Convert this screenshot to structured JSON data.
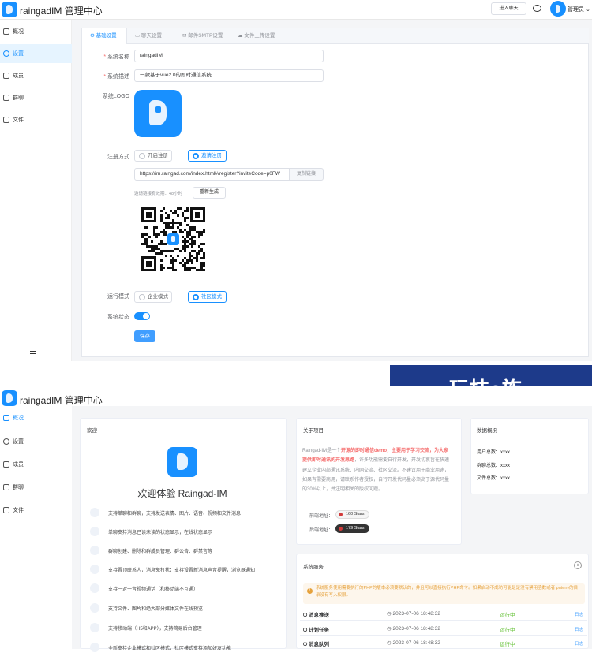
{
  "app": {
    "title": "raingadIM 管理中心",
    "enter_chat": "进入聊天",
    "user": "管理员"
  },
  "sidebar": {
    "items": [
      {
        "label": "概况",
        "icon": "dashboard-icon"
      },
      {
        "label": "设置",
        "icon": "gear-icon"
      },
      {
        "label": "成员",
        "icon": "user-icon"
      },
      {
        "label": "群聊",
        "icon": "chat-icon"
      },
      {
        "label": "文件",
        "icon": "folder-icon"
      }
    ]
  },
  "settings": {
    "tabs": [
      {
        "label": "基础设置",
        "icon": "gear-icon"
      },
      {
        "label": "聊天设置",
        "icon": "chat-icon"
      },
      {
        "label": "邮件SMTP设置",
        "icon": "mail-icon"
      },
      {
        "label": "文件上传设置",
        "icon": "cloud-upload-icon"
      }
    ],
    "name_label": "系统名称",
    "name_value": "raingadIM",
    "desc_label": "系统描述",
    "desc_value": "一款基于vue2.0的即时通信系统",
    "logo_label": "系统LOGO",
    "register_label": "注册方式",
    "register_options": [
      "开启注册",
      "邀请注册"
    ],
    "register_selected": "邀请注册",
    "invite_link": "https://im.raingad.com/index.html#/register?inviteCode=p0FW",
    "copy_link": "复制链接",
    "invite_hint": "邀请链接有效期：48小时",
    "regenerate": "重新生成",
    "mode_label": "运行模式",
    "mode_options": [
      "企业模式",
      "社区模式"
    ],
    "mode_selected": "社区模式",
    "status_label": "系统状态",
    "status_on": true,
    "save": "保存"
  },
  "banner": {
    "text": "玩技e族",
    "color": "#1d3a8a"
  },
  "welcome": {
    "panel_title": "欢迎",
    "title": "欢迎体验 Raingad-IM",
    "features": [
      "支持单聊和群聊，支持发送表情、图片、语音、视频和文件消息",
      "单聊支持消息已读未读的状态显示，在线状态显示",
      "群聊创建、删除和群成员管理、群公告、群禁言等",
      "支持置顶联系人，消息免打扰；支持设置新消息声音提醒，浏览器通知",
      "支持一对一音视频通话（和移动端不互通）",
      "支持文件、图片和绝大部分媒体文件在线预览",
      "支持移动端（H5和APP），支持简易后台管理",
      "全新支持企业模式和社区模式，社区模式支持添加好友功能"
    ]
  },
  "about": {
    "title": "关于项目",
    "text_a": "Raingad-IM是一个",
    "text_hl": "开源的即时通信demo，主要用于学习交流，为大家提供即时通讯的开发思路",
    "text_b": "，许多功能需要自行开发，开发初衷旨在快速建立企业内部通讯系统、内网交流、社区交流。不建议用于商业用途，如果有需要商用，请联系作者授权，自行开发代码量必须高于源代码量的30%以上，并注明相关的版权问题。",
    "frontend_label": "前端地址：",
    "frontend_stars": "160 Stars",
    "backend_label": "后端地址：",
    "backend_stars": "179 Stars"
  },
  "stats": {
    "title": "数据概况",
    "users": "用户总数：xxxx",
    "groups": "群聊总数：xxxx",
    "files": "文件总数：xxxx"
  },
  "services": {
    "title": "系统服务",
    "warning": "系统服务使用需要执行的PHP的版本必须要默认的，并且可以直接执行PHP命令。如果启动不成功可能是是没有禁用函数或者 putenv的目录没有写入权限。",
    "rows": [
      {
        "name": "消息推送",
        "time": "2023-07-06 18:48:32",
        "status": "运行中",
        "log": "日志"
      },
      {
        "name": "计划任务",
        "time": "2023-07-06 18:48:32",
        "status": "运行中",
        "log": "日志"
      },
      {
        "name": "消息队列",
        "time": "2023-07-06 18:48:32",
        "status": "运行中",
        "log": "日志"
      }
    ]
  }
}
